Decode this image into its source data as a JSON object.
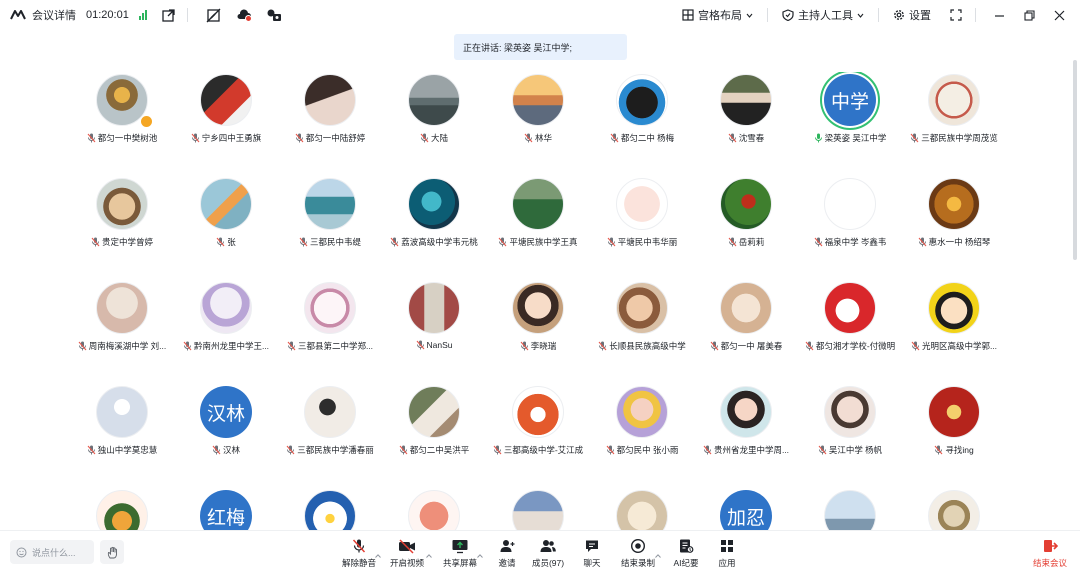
{
  "topbar": {
    "title": "会议详情",
    "timer": "01:20:01",
    "layout_label": "宫格布局",
    "host_tools_label": "主持人工具",
    "settings_label": "设置"
  },
  "speaker_toast": "正在讲话: 梁英姿 吴江中学;",
  "participants": [
    {
      "name": "都匀一中樊树池"
    },
    {
      "name": "宁乡四中王勇旗"
    },
    {
      "name": "都匀一中陆舒婷"
    },
    {
      "name": "大陆"
    },
    {
      "name": "林华"
    },
    {
      "name": "都匀二中 杨梅"
    },
    {
      "name": "沈雪春"
    },
    {
      "name": "梁英姿 吴江中学",
      "avatar_text": "中学"
    },
    {
      "name": "三都民族中学周茂览"
    },
    {
      "name": "贵定中学曾婷"
    },
    {
      "name": "张"
    },
    {
      "name": "三都民中韦缇"
    },
    {
      "name": "荔波高级中学韦元桃"
    },
    {
      "name": "平塘民族中学王真"
    },
    {
      "name": "平塘民中韦华丽"
    },
    {
      "name": "岳莉莉"
    },
    {
      "name": "福泉中学 岑鑫韦"
    },
    {
      "name": "惠水一中 杨绍琴"
    },
    {
      "name": "周南梅溪湖中学 刘..."
    },
    {
      "name": "黔南州龙里中学王..."
    },
    {
      "name": "三都县第二中学郑..."
    },
    {
      "name": "NanSu"
    },
    {
      "name": "李晓瑞"
    },
    {
      "name": "长顺县民族高级中学"
    },
    {
      "name": "都匀一中 屠美春"
    },
    {
      "name": "都匀湘才学校-付微明"
    },
    {
      "name": "光明区高级中学郭..."
    },
    {
      "name": "独山中学莫忠慧"
    },
    {
      "name": "汉林",
      "avatar_text": "汉林"
    },
    {
      "name": "三都民族中学潘春丽"
    },
    {
      "name": "都匀二中吴洪平"
    },
    {
      "name": "三都高级中学-艾江成"
    },
    {
      "name": "都匀民中 张小雨"
    },
    {
      "name": "贵州省龙里中学周..."
    },
    {
      "name": "吴江中学 杨帆"
    },
    {
      "name": "寻找ing"
    },
    {
      "name": ""
    },
    {
      "name": "",
      "avatar_text": "红梅"
    },
    {
      "name": ""
    },
    {
      "name": ""
    },
    {
      "name": ""
    },
    {
      "name": ""
    },
    {
      "name": "",
      "avatar_text": "加忍"
    },
    {
      "name": ""
    },
    {
      "name": ""
    }
  ],
  "bottombar": {
    "chat_placeholder": "说点什么...",
    "controls": [
      {
        "label": "解除静音",
        "icon": "mic-muted-icon"
      },
      {
        "label": "开启视频",
        "icon": "camera-off-icon"
      },
      {
        "label": "共享屏幕",
        "icon": "share-screen-icon"
      },
      {
        "label": "邀请",
        "icon": "invite-icon"
      },
      {
        "label": "成员(97)",
        "icon": "members-icon"
      },
      {
        "label": "聊天",
        "icon": "chat-icon"
      },
      {
        "label": "结束录制",
        "icon": "record-icon"
      },
      {
        "label": "AI纪要",
        "icon": "ai-notes-icon"
      },
      {
        "label": "应用",
        "icon": "apps-icon"
      }
    ],
    "end_label": "结束会议"
  },
  "colors": {
    "accent_blue": "#2f74c8",
    "speaking_green": "#33c073",
    "end_red": "#e33e33",
    "toast_bg": "#e8f1fd"
  }
}
